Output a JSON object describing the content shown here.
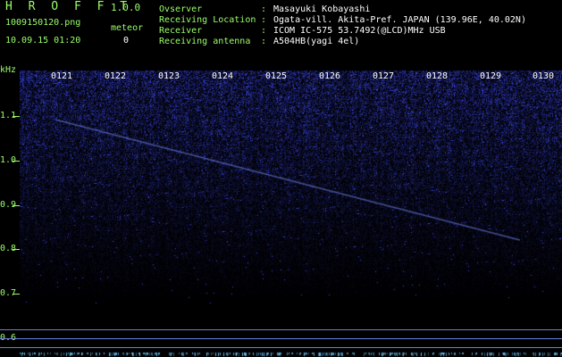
{
  "header": {
    "app_title": "H R O F F T",
    "version": "1.0.0",
    "file_name": "1009150120.png",
    "meteor_label": "meteor",
    "datetime": "10.09.15 01:20",
    "meteor_count": "0"
  },
  "info": [
    {
      "key": "Ovserver",
      "value": "Masayuki Kobayashi"
    },
    {
      "key": "Receiving Location",
      "value": "Ogata-vill. Akita-Pref. JAPAN (139.96E, 40.02N)"
    },
    {
      "key": "Receiver",
      "value": "ICOM IC-575 53.7492(@LCD)MHz USB"
    },
    {
      "key": "Receiving antenna",
      "value": "A504HB(yagi 4el)"
    }
  ],
  "separator": ":",
  "spectrogram": {
    "y_unit": "kHz",
    "y_ticks": [
      "1.1",
      "1.0",
      "0.9",
      "0.8",
      "0.7",
      "0.6"
    ],
    "x_ticks": [
      "0121",
      "0122",
      "0123",
      "0124",
      "0125",
      "0126",
      "0127",
      "0128",
      "0129",
      "0130"
    ]
  },
  "colors": {
    "label_green": "#9cff6a",
    "signal_blue": "#3a4cff",
    "background": "#000000"
  }
}
